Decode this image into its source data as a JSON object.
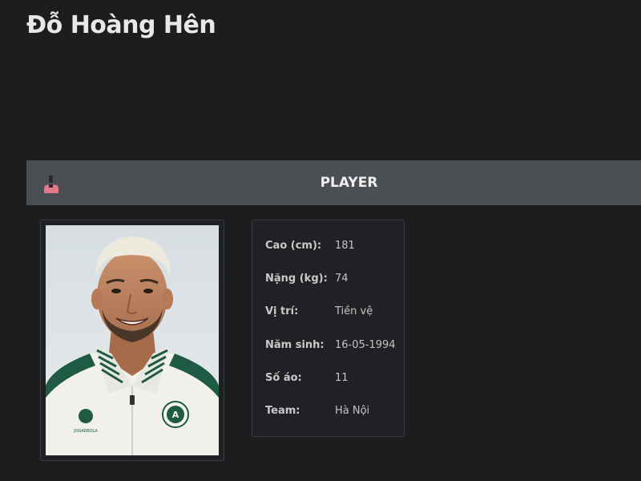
{
  "header": {
    "player_name": "Đỗ Hoàng Hên"
  },
  "section": {
    "title": "PLAYER",
    "icon": "user-icon"
  },
  "profile": {
    "photo": "player-photo",
    "rows": [
      {
        "label": "Cao (cm):",
        "value": "181"
      },
      {
        "label": "Nặng (kg):",
        "value": "74"
      },
      {
        "label": "Vị trí:",
        "value": "Tiền vệ"
      },
      {
        "label": "Năm sinh:",
        "value": "16-05-1994"
      },
      {
        "label": "Số áo:",
        "value": "11"
      },
      {
        "label": "Team:",
        "value": "Hà Nội"
      }
    ]
  },
  "colors": {
    "background": "#1c1d1f",
    "bar": "#4b4e52",
    "icon_accent": "#e07a86"
  }
}
